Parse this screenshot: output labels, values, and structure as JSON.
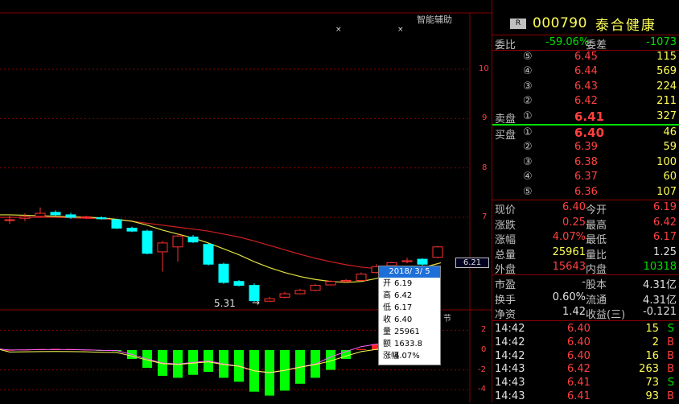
{
  "header": {
    "badge": "R",
    "code": "000790",
    "name": "泰合健康"
  },
  "chart": {
    "smart_help": "智能辅助",
    "low_label": "5.31",
    "low_arrow": "→",
    "current_price_tag": "6.21",
    "indicator_label": "节",
    "markers": [
      "×",
      "×"
    ],
    "price_axis": [
      "10",
      "9",
      "8",
      "7"
    ],
    "indicator_axis": [
      "2",
      "0",
      "-2",
      "-4"
    ],
    "candles": [
      {
        "o": 6.95,
        "c": 6.95,
        "h": 7.05,
        "l": 6.87
      },
      {
        "o": 6.98,
        "c": 7.01,
        "h": 7.08,
        "l": 6.92
      },
      {
        "o": 7.02,
        "c": 7.08,
        "h": 7.2,
        "l": 7.0
      },
      {
        "o": 7.1,
        "c": 7.05,
        "h": 7.14,
        "l": 7.02
      },
      {
        "o": 7.05,
        "c": 7.0,
        "h": 7.09,
        "l": 6.97
      },
      {
        "o": 7.0,
        "c": 7.01,
        "h": 7.03,
        "l": 6.97
      },
      {
        "o": 6.99,
        "c": 6.97,
        "h": 7.02,
        "l": 6.95
      },
      {
        "o": 6.95,
        "c": 6.78,
        "h": 6.97,
        "l": 6.76
      },
      {
        "o": 6.78,
        "c": 6.72,
        "h": 6.81,
        "l": 6.7
      },
      {
        "o": 6.72,
        "c": 6.27,
        "h": 6.75,
        "l": 6.25
      },
      {
        "o": 6.3,
        "c": 6.48,
        "h": 6.52,
        "l": 5.9
      },
      {
        "o": 6.4,
        "c": 6.62,
        "h": 6.68,
        "l": 6.1
      },
      {
        "o": 6.6,
        "c": 6.5,
        "h": 6.64,
        "l": 6.48
      },
      {
        "o": 6.45,
        "c": 6.05,
        "h": 6.47,
        "l": 6.02
      },
      {
        "o": 6.05,
        "c": 5.68,
        "h": 6.08,
        "l": 5.65
      },
      {
        "o": 5.7,
        "c": 5.62,
        "h": 5.73,
        "l": 5.6
      },
      {
        "o": 5.62,
        "c": 5.31,
        "h": 5.66,
        "l": 5.29
      },
      {
        "o": 5.3,
        "c": 5.35,
        "h": 5.39,
        "l": 5.29
      },
      {
        "o": 5.38,
        "c": 5.45,
        "h": 5.49,
        "l": 5.36
      },
      {
        "o": 5.45,
        "c": 5.52,
        "h": 5.55,
        "l": 5.44
      },
      {
        "o": 5.52,
        "c": 5.62,
        "h": 5.65,
        "l": 5.5
      },
      {
        "o": 5.63,
        "c": 5.7,
        "h": 5.72,
        "l": 5.62
      },
      {
        "o": 5.7,
        "c": 5.72,
        "h": 5.75,
        "l": 5.68
      },
      {
        "o": 5.72,
        "c": 5.85,
        "h": 5.88,
        "l": 5.7
      },
      {
        "o": 5.88,
        "c": 6.0,
        "h": 6.05,
        "l": 5.86
      },
      {
        "o": 6.02,
        "c": 6.08,
        "h": 6.1,
        "l": 5.99
      },
      {
        "o": 6.1,
        "c": 6.12,
        "h": 6.18,
        "l": 6.07
      },
      {
        "o": 6.15,
        "c": 6.05,
        "h": 6.17,
        "l": 6.02
      },
      {
        "o": 6.19,
        "c": 6.4,
        "h": 6.42,
        "l": 6.17
      }
    ],
    "ma_red": [
      7.0,
      7.0,
      7.0,
      7.0,
      6.99,
      6.98,
      6.97,
      6.95,
      6.92,
      6.88,
      6.84,
      6.8,
      6.76,
      6.72,
      6.66,
      6.6,
      6.52,
      6.43,
      6.34,
      6.25,
      6.17,
      6.1,
      6.04,
      5.99,
      5.96,
      5.94,
      5.93,
      5.95,
      5.98
    ],
    "ma_yellow": [
      7.05,
      7.04,
      7.03,
      7.02,
      7.01,
      7.0,
      6.99,
      6.96,
      6.92,
      6.84,
      6.74,
      6.66,
      6.58,
      6.48,
      6.36,
      6.24,
      6.1,
      5.98,
      5.88,
      5.8,
      5.74,
      5.7,
      5.68,
      5.7,
      5.76,
      5.84,
      5.92,
      5.98,
      6.06
    ],
    "macd_bars": [
      0.02,
      0.05,
      0.1,
      0.12,
      0.1,
      0.05,
      -0.05,
      -0.1,
      -0.9,
      -1.8,
      -2.6,
      -2.8,
      -2.5,
      -2.2,
      -2.8,
      -3.2,
      -4.2,
      -4.6,
      -4.1,
      -3.4,
      -2.8,
      -2.0,
      -0.9,
      0.1,
      0.6,
      1.1,
      1.6,
      1.8
    ]
  },
  "tooltip": {
    "date": "2018/ 3/ 5",
    "rows": [
      {
        "k": "开",
        "v": "6.19"
      },
      {
        "k": "高",
        "v": "6.42"
      },
      {
        "k": "低",
        "v": "6.17"
      },
      {
        "k": "收",
        "v": "6.40"
      },
      {
        "k": "量",
        "v": "25961"
      },
      {
        "k": "额",
        "v": "1633.8"
      },
      {
        "k": "涨幅",
        "v": "4.07%"
      }
    ]
  },
  "panel": {
    "weibi_label": "委比",
    "weibi": "-59.06%",
    "weicha_label": "委差",
    "weicha": "-1073",
    "sell_label": "卖盘",
    "buy_label": "买盘",
    "asks": [
      {
        "n": "⑤",
        "p": "6.45",
        "v": "115"
      },
      {
        "n": "④",
        "p": "6.44",
        "v": "569"
      },
      {
        "n": "③",
        "p": "6.43",
        "v": "224"
      },
      {
        "n": "②",
        "p": "6.42",
        "v": "211"
      },
      {
        "n": "①",
        "p": "6.41",
        "v": "327"
      }
    ],
    "bids": [
      {
        "n": "①",
        "p": "6.40",
        "v": "46"
      },
      {
        "n": "②",
        "p": "6.39",
        "v": "59"
      },
      {
        "n": "③",
        "p": "6.38",
        "v": "100"
      },
      {
        "n": "④",
        "p": "6.37",
        "v": "60"
      },
      {
        "n": "⑤",
        "p": "6.36",
        "v": "107"
      }
    ],
    "stats": [
      {
        "l1": "现价",
        "v1": "6.40",
        "c1": "red",
        "l2": "今开",
        "v2": "6.19",
        "c2": "red"
      },
      {
        "l1": "涨跌",
        "v1": "0.25",
        "c1": "red",
        "l2": "最高",
        "v2": "6.42",
        "c2": "red"
      },
      {
        "l1": "涨幅",
        "v1": "4.07%",
        "c1": "red",
        "l2": "最低",
        "v2": "6.17",
        "c2": "red"
      },
      {
        "l1": "总量",
        "v1": "25961",
        "c1": "yellow",
        "l2": "量比",
        "v2": "1.25",
        "c2": "white"
      },
      {
        "l1": "外盘",
        "v1": "15643",
        "c1": "red",
        "l2": "内盘",
        "v2": "10318",
        "c2": "green"
      }
    ],
    "stats2": [
      {
        "l1": "市盈",
        "v1": "-",
        "l2": "股本",
        "v2": "4.31亿"
      },
      {
        "l1": "换手",
        "v1": "0.60%",
        "l2": "流通",
        "v2": "4.31亿"
      },
      {
        "l1": "净资",
        "v1": "1.42",
        "l2": "收益(三)",
        "v2": "-0.121"
      }
    ],
    "trades": [
      {
        "t": "14:42",
        "p": "6.40",
        "v": "15",
        "s": "S"
      },
      {
        "t": "14:42",
        "p": "6.40",
        "v": "2",
        "s": "B"
      },
      {
        "t": "14:42",
        "p": "6.40",
        "v": "16",
        "s": "B"
      },
      {
        "t": "14:43",
        "p": "6.42",
        "v": "263",
        "s": "B"
      },
      {
        "t": "14:43",
        "p": "6.41",
        "v": "73",
        "s": "S"
      },
      {
        "t": "14:43",
        "p": "6.41",
        "v": "93",
        "s": "B"
      }
    ]
  }
}
